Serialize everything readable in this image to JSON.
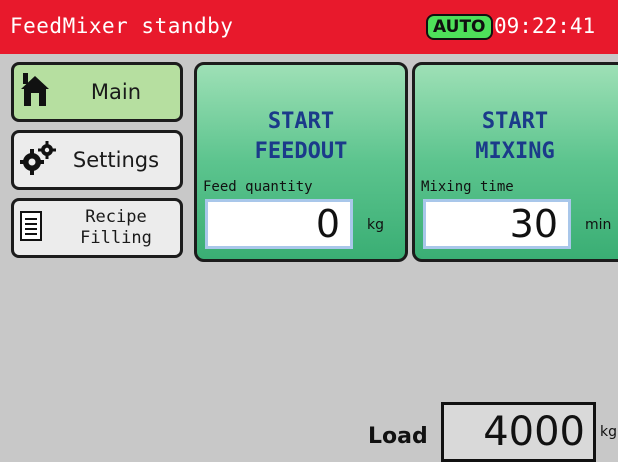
{
  "header": {
    "title": "FeedMixer standby",
    "mode_badge": "AUTO",
    "time": "09:22:41",
    "colors": {
      "background": "#e8192c",
      "badge": "#4ee05a"
    }
  },
  "menu": [
    {
      "label": "Main",
      "icon": "house-icon",
      "active": true
    },
    {
      "label": "Settings",
      "icon": "gears-icon",
      "active": false
    },
    {
      "label": "Recipe\nFilling",
      "icon": "document-icon",
      "active": false
    }
  ],
  "tiles": {
    "feedout": {
      "title": "START\nFEEDOUT",
      "field_label": "Feed quantity",
      "value": "0",
      "unit": "kg"
    },
    "mixing": {
      "title": "START\nMIXING",
      "field_label": "Mixing time",
      "value": "30",
      "unit": "min"
    }
  },
  "load": {
    "label": "Load",
    "value": "4000",
    "unit": "kg"
  }
}
